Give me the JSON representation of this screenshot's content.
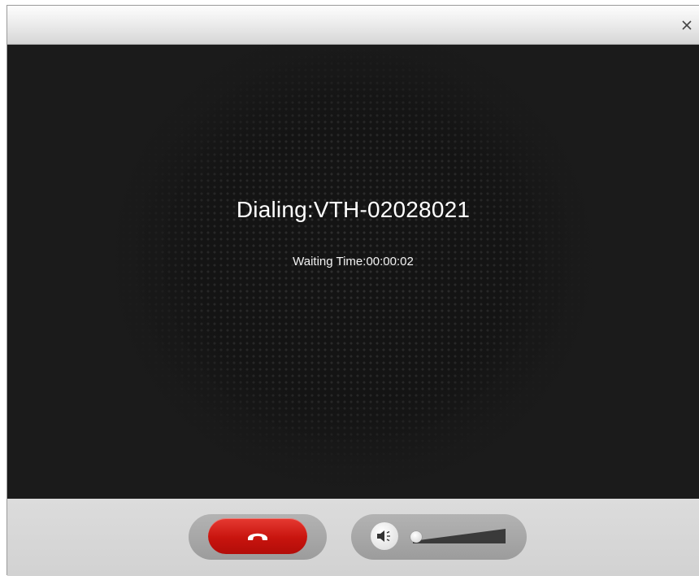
{
  "window": {
    "close_glyph": "×"
  },
  "call": {
    "dialing_label": "Dialing:VTH-02028021",
    "waiting_label": "Waiting Time:00:00:02"
  },
  "controls": {
    "hangup_icon": "phone-hangup-icon",
    "speaker_icon": "speaker-icon",
    "volume_level": 0.0
  },
  "colors": {
    "hangup_red": "#d41a12",
    "video_background": "#1b1b1b",
    "control_bar": "#d6d6d6"
  }
}
